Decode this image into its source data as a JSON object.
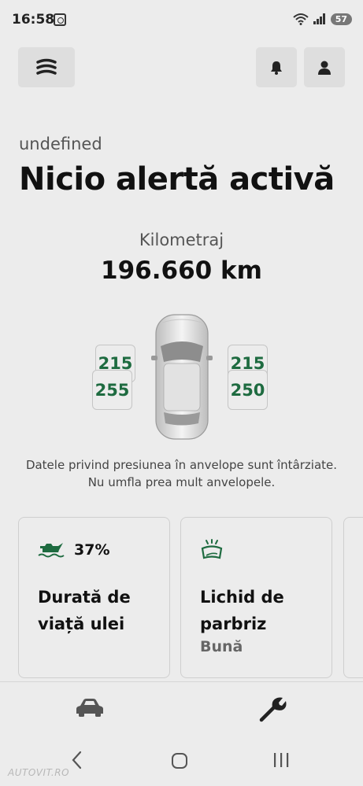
{
  "status_bar": {
    "time": "16:58",
    "battery": "57",
    "icons": [
      "screenshot-icon",
      "wifi-icon",
      "signal-icon",
      "battery-icon"
    ]
  },
  "header": {
    "menu_icon": "menu-stack-icon",
    "notifications_icon": "bell-icon",
    "profile_icon": "user-icon"
  },
  "vehicle": {
    "name": "undefined",
    "alert_title": "Nicio alertă activă"
  },
  "mileage": {
    "label": "Kilometraj",
    "value": "196.660 km"
  },
  "tires": {
    "front_left": "215",
    "rear_left": "255",
    "front_right": "215",
    "rear_right": "250",
    "value_color": "#1e6b40",
    "note": "Datele privind presiunea în anvelope sunt întârziate. Nu umfla prea mult anvelopele."
  },
  "cards": [
    {
      "icon": "oil-can-icon",
      "percent": "37%",
      "title": "Durată de viață ulei"
    },
    {
      "icon": "windshield-washer-icon",
      "title": "Lichid de parbriz",
      "status": "Bună"
    }
  ],
  "bottom_nav": {
    "items": [
      {
        "icon": "car-icon"
      },
      {
        "icon": "wrench-icon"
      }
    ]
  },
  "system_nav": {
    "icons": [
      "back-icon",
      "home-icon",
      "recents-icon"
    ]
  },
  "watermark": "AUTOVIT.RO",
  "colors": {
    "background": "#ececec",
    "accent_green": "#1e6b40"
  }
}
